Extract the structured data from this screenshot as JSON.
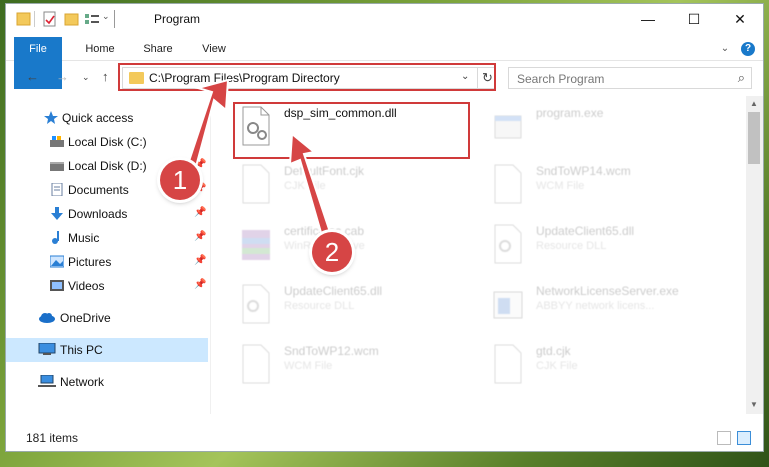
{
  "window": {
    "title": "Program",
    "minimize_glyph": "—",
    "maximize_glyph": "☐",
    "close_glyph": "✕"
  },
  "ribbon": {
    "tabs": [
      "File",
      "Home",
      "Share",
      "View"
    ],
    "chevron_glyph": "⌄",
    "help_glyph": "?"
  },
  "nav": {
    "back_glyph": "←",
    "forward_glyph": "→",
    "recent_glyph": "⌄",
    "up_glyph": "↑",
    "address": "C:\\Program Files\\Program Directory",
    "address_chevron": "⌄",
    "refresh_glyph": "↻",
    "search_placeholder": "Search Program",
    "search_glyph": "⌕"
  },
  "sidebar": {
    "pin_glyph": "📌",
    "items": [
      {
        "label": "Quick access",
        "icon": "star-icon"
      },
      {
        "label": "Local Disk (C:)",
        "icon": "drive-icon"
      },
      {
        "label": "Local Disk (D:)",
        "icon": "drive-icon"
      },
      {
        "label": "Documents",
        "icon": "documents-icon"
      },
      {
        "label": "Downloads",
        "icon": "downloads-icon"
      },
      {
        "label": "Music",
        "icon": "music-icon"
      },
      {
        "label": "Pictures",
        "icon": "pictures-icon"
      },
      {
        "label": "Videos",
        "icon": "videos-icon"
      },
      {
        "label": "OneDrive",
        "icon": "cloud-icon"
      },
      {
        "label": "This PC",
        "icon": "computer-icon"
      },
      {
        "label": "Network",
        "icon": "network-icon"
      }
    ],
    "selected": "This PC"
  },
  "files": [
    {
      "name": "dsp_sim_common.dll",
      "type": "",
      "icon": "dll-gear-icon"
    },
    {
      "name": "program.exe",
      "type": "",
      "icon": "exe-icon"
    },
    {
      "name": "DefaultFont.cjk",
      "type": "CJK File",
      "icon": "blank-file-icon"
    },
    {
      "name": "SndToWP14.wcm",
      "type": "WCM File",
      "icon": "blank-file-icon"
    },
    {
      "name": "certificates.cab",
      "type": "WinRAR archive",
      "icon": "winrar-icon"
    },
    {
      "name": "UpdateClient65.dll",
      "type": "Resource DLL",
      "icon": "dll-gear-icon"
    },
    {
      "name": "UpdateClient65.dll",
      "type": "Resource DLL",
      "icon": "dll-gear-icon"
    },
    {
      "name": "NetworkLicenseServer.exe",
      "type": "ABBYY network licens...",
      "icon": "exe-window-icon"
    },
    {
      "name": "SndToWP12.wcm",
      "type": "WCM File",
      "icon": "blank-file-icon"
    },
    {
      "name": "gtd.cjk",
      "type": "CJK File",
      "icon": "blank-file-icon"
    }
  ],
  "annotations": {
    "callout_1": "1",
    "callout_2": "2",
    "color": "#d03a3a"
  },
  "status": {
    "item_count": "181 items"
  },
  "colors": {
    "accent": "#1979ca",
    "selection": "#cce8ff",
    "folder": "#f3c95b"
  }
}
